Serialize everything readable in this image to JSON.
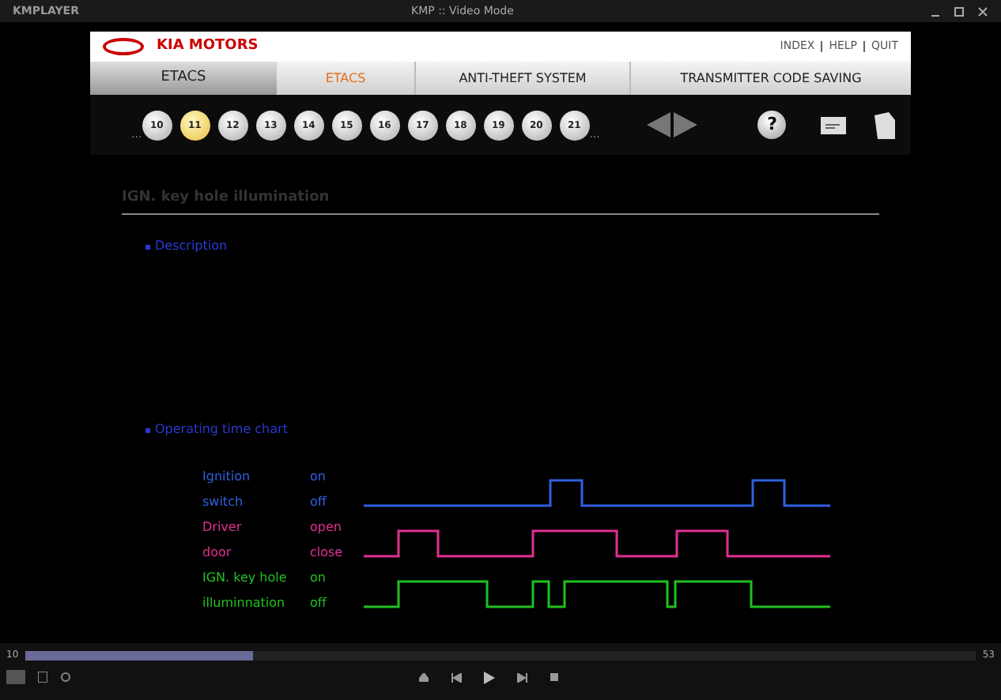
{
  "window": {
    "app_name": "KMPLAYER",
    "title": "KMP :: Video Mode"
  },
  "header": {
    "brand": "KIA MOTORS",
    "links": [
      "INDEX",
      "HELP",
      "QUIT"
    ]
  },
  "tabs": [
    {
      "label": "ETACS",
      "kind": "section",
      "selected": false
    },
    {
      "label": "ETACS",
      "kind": "tab",
      "selected": true
    },
    {
      "label": "ANTI-THEFT SYSTEM",
      "kind": "tab",
      "selected": false
    },
    {
      "label": "TRANSMITTER CODE SAVING",
      "kind": "tab",
      "selected": false
    }
  ],
  "pages": {
    "more_before": "...",
    "more_after": "...",
    "items": [
      {
        "label": "10",
        "selected": false
      },
      {
        "label": "11",
        "selected": true
      },
      {
        "label": "12",
        "selected": false
      },
      {
        "label": "13",
        "selected": false
      },
      {
        "label": "14",
        "selected": false
      },
      {
        "label": "15",
        "selected": false
      },
      {
        "label": "16",
        "selected": false
      },
      {
        "label": "17",
        "selected": false
      },
      {
        "label": "18",
        "selected": false
      },
      {
        "label": "19",
        "selected": false
      },
      {
        "label": "20",
        "selected": false
      },
      {
        "label": "21",
        "selected": false
      }
    ]
  },
  "toolbar": {
    "help_label": "?"
  },
  "page_title": "IGN. key hole illumination",
  "sections": [
    "Description",
    "Operating time chart"
  ],
  "chart_rows": [
    {
      "name_lines": [
        "Ignition",
        "switch"
      ],
      "states": [
        "on",
        "off"
      ],
      "color": "#3060e0"
    },
    {
      "name_lines": [
        "Driver",
        "door"
      ],
      "states": [
        "open",
        "close"
      ],
      "color": "#e03090"
    },
    {
      "name_lines": [
        "IGN. key hole",
        "illuminnation"
      ],
      "states": [
        "on",
        "off"
      ],
      "color": "#20c020"
    }
  ],
  "player": {
    "time_start": "10",
    "time_end": "53",
    "seek": {
      "level": 0.24
    }
  }
}
